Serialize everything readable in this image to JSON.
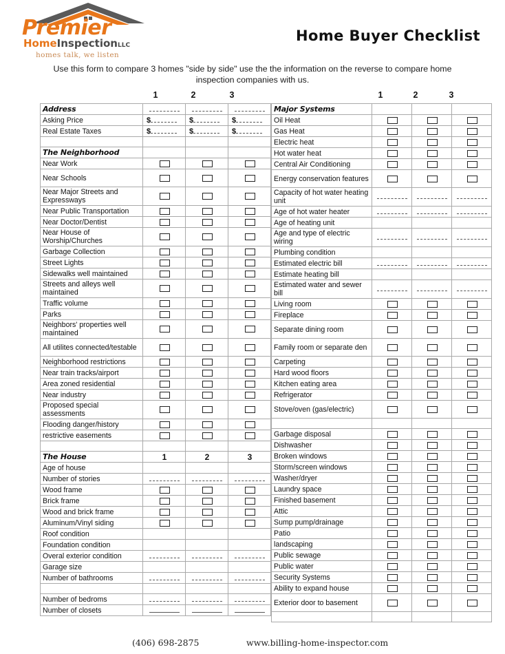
{
  "brand": {
    "name_top": "Premier",
    "name_home": "Home",
    "name_inspection": "Inspection",
    "name_llc": "LLC",
    "tagline": "homes talk, we listen",
    "roof_color_outer": "#5A5A5A",
    "roof_color_inner": "#E8761A",
    "accent_color": "#E8761A"
  },
  "header": {
    "title": "Home Buyer Checklist",
    "intro": "Use this form to compare 3 homes \"side by side\" use the the information on the reverse to compare home inspection companies with us."
  },
  "column_headers": [
    "1",
    "2",
    "3"
  ],
  "footer": {
    "phone": "(406) 698-2875",
    "website": "www.billing-home-inspector.com"
  },
  "left_table": {
    "rows": [
      {
        "label": "Address",
        "style": "section",
        "cells": "blank"
      },
      {
        "label": "Asking Price",
        "style": "normal",
        "cells": "money"
      },
      {
        "label": "Real Estate Taxes",
        "style": "normal",
        "cells": "money"
      },
      {
        "label": "",
        "style": "spacer",
        "cells": "empty"
      },
      {
        "label": "The Neighborhood",
        "style": "section",
        "cells": "empty"
      },
      {
        "label": "Near Work",
        "style": "normal",
        "cells": "checkbox"
      },
      {
        "label": "Near Schools",
        "style": "normal",
        "cells": "checkbox",
        "tall": true
      },
      {
        "label": "Near Major Streets and Expressways",
        "style": "normal",
        "cells": "checkbox",
        "tall": true
      },
      {
        "label": "Near Public Transportation",
        "style": "normal",
        "cells": "checkbox"
      },
      {
        "label": "Near Doctor/Dentist",
        "style": "normal",
        "cells": "checkbox"
      },
      {
        "label": "Near House of Worship/Churches",
        "style": "normal",
        "cells": "checkbox",
        "tall": true
      },
      {
        "label": "Garbage Collection",
        "style": "normal",
        "cells": "checkbox"
      },
      {
        "label": "Street Lights",
        "style": "normal",
        "cells": "checkbox"
      },
      {
        "label": "Sidewalks well maintained",
        "style": "normal",
        "cells": "checkbox"
      },
      {
        "label": "Streets and alleys well maintained",
        "style": "normal",
        "cells": "checkbox",
        "tall": true
      },
      {
        "label": "Traffic volume",
        "style": "normal",
        "cells": "checkbox"
      },
      {
        "label": "Parks",
        "style": "normal",
        "cells": "checkbox"
      },
      {
        "label": "Neighbors' properties well maintained",
        "style": "normal",
        "cells": "checkbox",
        "tall": true
      },
      {
        "label": "All utilites connected/testable",
        "style": "normal",
        "cells": "checkbox",
        "tall": true
      },
      {
        "label": "Neighborhood restrictions",
        "style": "normal",
        "cells": "checkbox"
      },
      {
        "label": "Near train tracks/airport",
        "style": "normal",
        "cells": "checkbox"
      },
      {
        "label": "Area zoned residential",
        "style": "normal",
        "cells": "checkbox"
      },
      {
        "label": "Near industry",
        "style": "normal",
        "cells": "checkbox"
      },
      {
        "label": "Proposed special assessments",
        "style": "normal",
        "cells": "checkbox",
        "tall": true
      },
      {
        "label": "Flooding danger/history",
        "style": "normal",
        "cells": "checkbox"
      },
      {
        "label": "restrictive easements",
        "style": "normal",
        "cells": "checkbox"
      },
      {
        "label": "",
        "style": "spacer",
        "cells": "empty"
      },
      {
        "label": "The House",
        "style": "section",
        "cells": "numbers"
      },
      {
        "label": "Age of house",
        "style": "normal",
        "cells": "empty"
      },
      {
        "label": "Number of stories",
        "style": "normal",
        "cells": "blank"
      },
      {
        "label": "Wood frame",
        "style": "normal",
        "cells": "checkbox"
      },
      {
        "label": "Brick frame",
        "style": "normal",
        "cells": "checkbox"
      },
      {
        "label": "Wood and brick frame",
        "style": "normal",
        "cells": "checkbox"
      },
      {
        "label": "Aluminum/Vinyl siding",
        "style": "normal",
        "cells": "checkbox"
      },
      {
        "label": "Roof condition",
        "style": "normal",
        "cells": "empty"
      },
      {
        "label": "Foundation condition",
        "style": "normal",
        "cells": "empty"
      },
      {
        "label": "Overal exterior condition",
        "style": "normal",
        "cells": "blank"
      },
      {
        "label": "Garage size",
        "style": "normal",
        "cells": "empty"
      },
      {
        "label": "Number of bathrooms",
        "style": "normal",
        "cells": "blank"
      },
      {
        "label": "",
        "style": "spacer",
        "cells": "empty"
      },
      {
        "label": "Number of bedroms",
        "style": "normal",
        "cells": "blank"
      },
      {
        "label": "Number of closets",
        "style": "normal",
        "cells": "blank-solid"
      }
    ]
  },
  "right_table": {
    "rows": [
      {
        "label": "Major Systems",
        "style": "section",
        "cells": "empty"
      },
      {
        "label": "Oil Heat",
        "style": "normal",
        "cells": "checkbox"
      },
      {
        "label": "Gas Heat",
        "style": "normal",
        "cells": "checkbox"
      },
      {
        "label": "Electric heat",
        "style": "normal",
        "cells": "checkbox"
      },
      {
        "label": "Hot water heat",
        "style": "normal",
        "cells": "checkbox"
      },
      {
        "label": "Central Air Conditioning",
        "style": "normal",
        "cells": "checkbox"
      },
      {
        "label": "Energy conservation features",
        "style": "normal",
        "cells": "checkbox",
        "tall": true
      },
      {
        "label": "Capacity of hot water heating unit",
        "style": "normal",
        "cells": "blank",
        "tall": true
      },
      {
        "label": "Age of hot water heater",
        "style": "normal",
        "cells": "blank"
      },
      {
        "label": "Age of heating unit",
        "style": "normal",
        "cells": "empty"
      },
      {
        "label": "Age and type of electric wiring",
        "style": "normal",
        "cells": "blank",
        "tall": true
      },
      {
        "label": "Plumbing condition",
        "style": "normal",
        "cells": "empty"
      },
      {
        "label": "Estimated electric bill",
        "style": "normal",
        "cells": "blank"
      },
      {
        "label": "Estimate heating bill",
        "style": "normal",
        "cells": "empty"
      },
      {
        "label": "Estimated water and sewer bill",
        "style": "normal",
        "cells": "blank",
        "tall": true
      },
      {
        "label": "Living room",
        "style": "normal",
        "cells": "checkbox"
      },
      {
        "label": "Fireplace",
        "style": "normal",
        "cells": "checkbox"
      },
      {
        "label": "Separate dining room",
        "style": "normal",
        "cells": "checkbox",
        "tall": true
      },
      {
        "label": "Family room or separate den",
        "style": "normal",
        "cells": "checkbox",
        "tall": true
      },
      {
        "label": "Carpeting",
        "style": "normal",
        "cells": "checkbox"
      },
      {
        "label": "Hard wood floors",
        "style": "normal",
        "cells": "checkbox"
      },
      {
        "label": "Kitchen eating area",
        "style": "normal",
        "cells": "checkbox"
      },
      {
        "label": "Refrigerator",
        "style": "normal",
        "cells": "checkbox"
      },
      {
        "label": "Stove/oven (gas/electric)",
        "style": "normal",
        "cells": "checkbox",
        "tall": true
      },
      {
        "label": "",
        "style": "spacer",
        "cells": "empty"
      },
      {
        "label": "Garbage disposal",
        "style": "normal",
        "cells": "checkbox"
      },
      {
        "label": "Dishwasher",
        "style": "normal",
        "cells": "checkbox"
      },
      {
        "label": "Broken windows",
        "style": "normal",
        "cells": "checkbox"
      },
      {
        "label": "Storm/screen windows",
        "style": "normal",
        "cells": "checkbox"
      },
      {
        "label": "Washer/dryer",
        "style": "normal",
        "cells": "checkbox"
      },
      {
        "label": "Laundry space",
        "style": "normal",
        "cells": "checkbox"
      },
      {
        "label": "Finished basement",
        "style": "normal",
        "cells": "checkbox"
      },
      {
        "label": "Attic",
        "style": "normal",
        "cells": "checkbox"
      },
      {
        "label": "Sump pump/drainage",
        "style": "normal",
        "cells": "checkbox"
      },
      {
        "label": "Patio",
        "style": "normal",
        "cells": "checkbox"
      },
      {
        "label": "landscaping",
        "style": "normal",
        "cells": "checkbox"
      },
      {
        "label": "Public sewage",
        "style": "normal",
        "cells": "checkbox"
      },
      {
        "label": "Public water",
        "style": "normal",
        "cells": "checkbox"
      },
      {
        "label": "Security Systems",
        "style": "normal",
        "cells": "checkbox"
      },
      {
        "label": "Ability to expand house",
        "style": "normal",
        "cells": "checkbox"
      },
      {
        "label": "Exterior door to basement",
        "style": "normal",
        "cells": "checkbox",
        "tall": true
      },
      {
        "label": "",
        "style": "spacer",
        "cells": "empty"
      }
    ]
  }
}
